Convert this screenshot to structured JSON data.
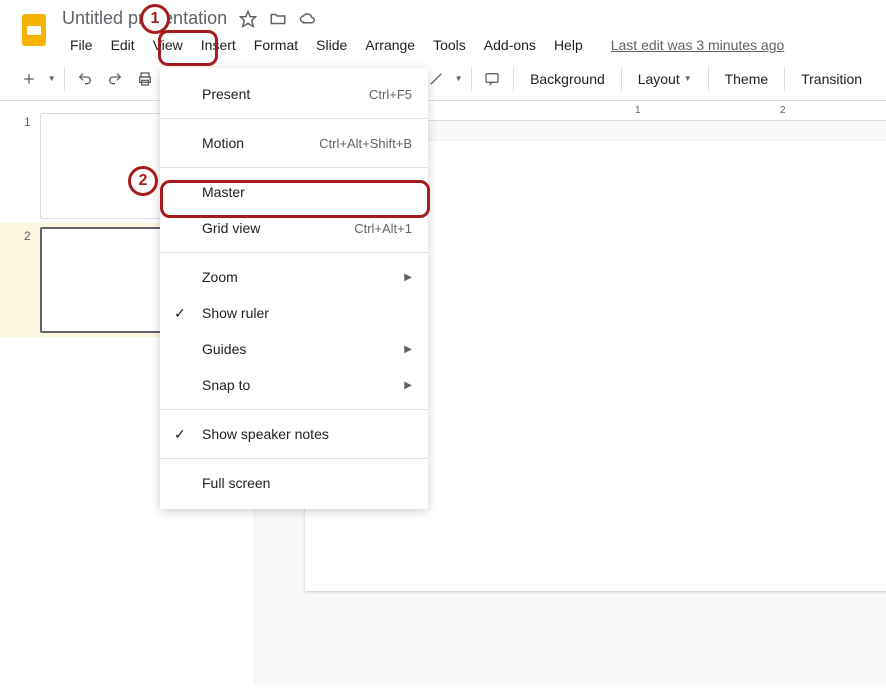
{
  "doc": {
    "title": "Untitled presentation"
  },
  "menubar": {
    "file": "File",
    "edit": "Edit",
    "view": "View",
    "insert": "Insert",
    "format": "Format",
    "slide": "Slide",
    "arrange": "Arrange",
    "tools": "Tools",
    "addons": "Add-ons",
    "help": "Help",
    "last_edit": "Last edit was 3 minutes ago"
  },
  "toolbar": {
    "background": "Background",
    "layout": "Layout",
    "theme": "Theme",
    "transition": "Transition"
  },
  "view_menu": {
    "present": {
      "label": "Present",
      "shortcut": "Ctrl+F5"
    },
    "motion": {
      "label": "Motion",
      "shortcut": "Ctrl+Alt+Shift+B"
    },
    "master": {
      "label": "Master"
    },
    "grid_view": {
      "label": "Grid view",
      "shortcut": "Ctrl+Alt+1"
    },
    "zoom": {
      "label": "Zoom"
    },
    "show_ruler": {
      "label": "Show ruler"
    },
    "guides": {
      "label": "Guides"
    },
    "snap_to": {
      "label": "Snap to"
    },
    "speaker_notes": {
      "label": "Show speaker notes"
    },
    "full_screen": {
      "label": "Full screen"
    }
  },
  "slides": {
    "s1": "1",
    "s2": "2"
  },
  "ruler": {
    "t1": "1",
    "t2": "2"
  },
  "annotations": {
    "a1": "1",
    "a2": "2"
  }
}
